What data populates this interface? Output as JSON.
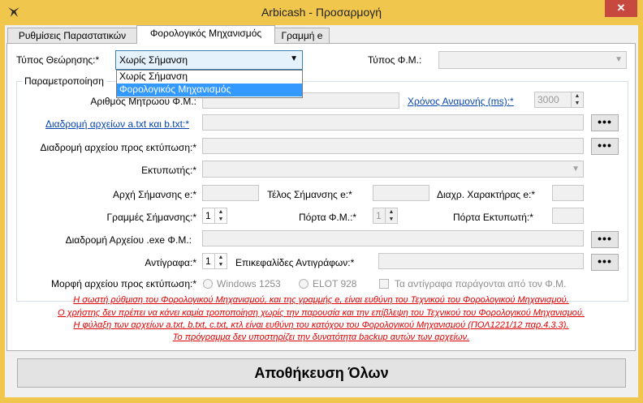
{
  "window": {
    "title": "Arbicash - Προσαρμογή",
    "close_glyph": "✕",
    "app_icon": "bird-logo-icon"
  },
  "tabs": [
    {
      "label": "Ρυθμίσεις Παραστατικών"
    },
    {
      "label": "Φορολογικός Μηχανισμός"
    },
    {
      "label": "Γραμμή e"
    }
  ],
  "form": {
    "view_type_label": "Τύπος Θεώρησης:*",
    "view_type_value": "Χωρίς Σήμανση",
    "view_type_options": [
      "Χωρίς Σήμανση",
      "Φορολογικός Μηχανισμός"
    ],
    "fm_type_label": "Τύπος Φ.Μ.:",
    "group_title": "Παραμετροποίηση",
    "register_number_label": "Αριθμός Μητρώου Φ.Μ.:",
    "wait_time_label": "Χρόνος Αναμονής (ms):*",
    "wait_time_value": "3000",
    "files_path_label": "Διαδρομή αρχείων a.txt και b.txt:*",
    "print_file_path_label": "Διαδρομή αρχείου προς εκτύπωση:*",
    "printer_label": "Εκτυπωτής:*",
    "mark_start_label": "Αρχή Σήμανσης e:*",
    "mark_end_label": "Τέλος Σήμανσης e:*",
    "separator_label": "Διαχρ. Χαρακτήρας e:*",
    "mark_lines_label": "Γραμμές Σήμανσης:*",
    "mark_lines_value": "1",
    "fm_port_label": "Πόρτα Φ.Μ.:*",
    "fm_port_value": "1",
    "printer_port_label": "Πόρτα Εκτυπωτή:*",
    "exe_path_label": "Διαδρομή Αρχείου .exe Φ.Μ.:",
    "copies_label": "Αντίγραφα:*",
    "copies_value": "1",
    "copy_headers_label": "Επικεφαλίδες Αντιγράφων:*",
    "print_format_label": "Μορφή αρχείου προς εκτύπωση:*",
    "format_windows": "Windows 1253",
    "format_elot": "ELOT 928",
    "copies_from_fm_label": "Τα αντίγραφα παράγονται από τον Φ.Μ.",
    "browse_label": "•••"
  },
  "warnings": [
    "Η σωστή ρύθμιση του Φορολογικού Μηχανισμού, και της γραμμής e, είναι ευθύνη του Τεχνικού του Φορολογικού Μηχανισμού.",
    "Ο χρήστης δεν πρέπει να κάνει καμία τροποποίηση χωρίς την παρουσία και την επίβλεψη του Τεχνικού του Φορολογικού Μηχανισμού.",
    "Η φύλαξη των αρχείων a.txt, b.txt, c.txt, κτλ είναι ευθύνη του κατόχου του Φορολογικού Μηχανισμού (ΠΟΛ1221/12 παρ.4.3.3).",
    "Το πρόγραμμα δεν υποστηρίζει την δυνατότητα backup αυτών των αρχείων."
  ],
  "footer": {
    "save_all_label": "Αποθήκευση Όλων"
  },
  "colors": {
    "titlebar": "#f0c74c",
    "close": "#c7483f",
    "warning": "#e00000",
    "link": "#0645ad",
    "selection": "#3399ff"
  }
}
